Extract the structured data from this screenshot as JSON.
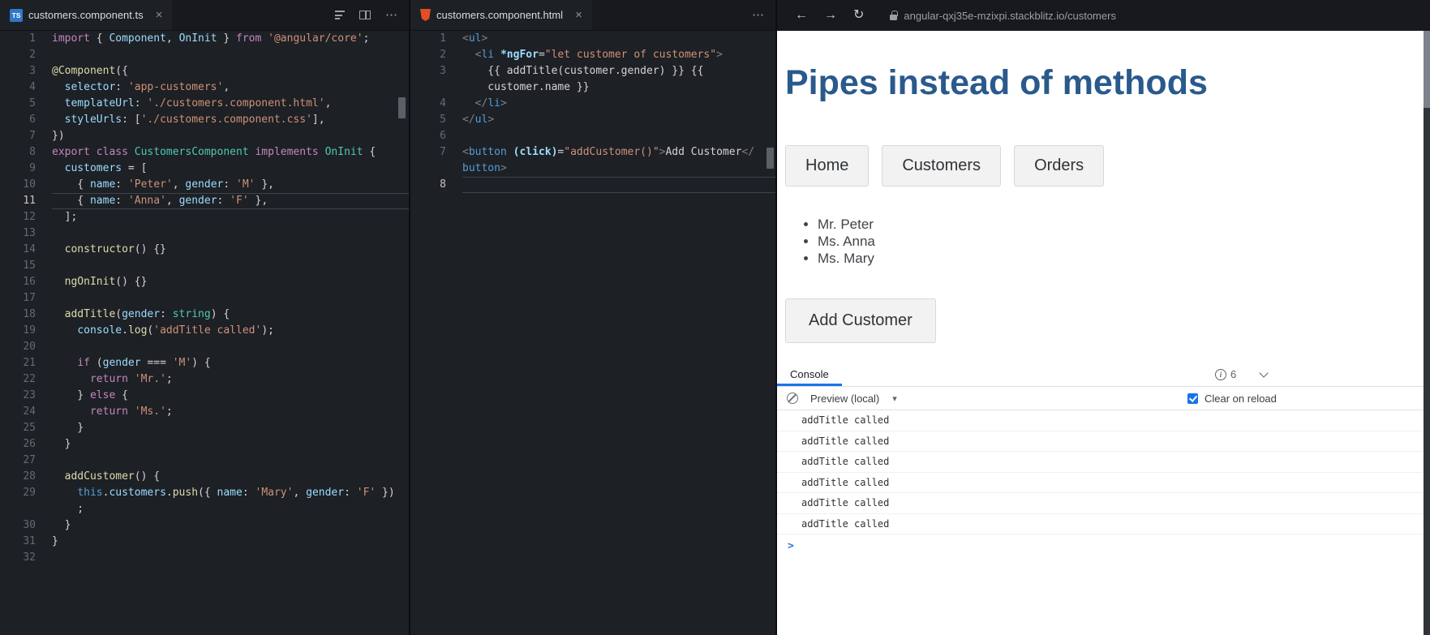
{
  "icons": {
    "close": "×",
    "more": "⋯",
    "back": "←",
    "forward": "→",
    "reload": "↻",
    "caret": "▾",
    "prompt": ">"
  },
  "left_editor": {
    "tab_title": "customers.component.ts",
    "file_icon_label": "TS",
    "rows": [
      {
        "n": "1",
        "segs": [
          [
            "k",
            "import"
          ],
          [
            "p",
            " { "
          ],
          [
            "v",
            "Component"
          ],
          [
            "p",
            ", "
          ],
          [
            "v",
            "OnInit"
          ],
          [
            "p",
            " } "
          ],
          [
            "k",
            "from"
          ],
          [
            "p",
            " "
          ],
          [
            "s",
            "'@angular/core'"
          ],
          [
            "p",
            ";"
          ]
        ]
      },
      {
        "n": "2",
        "segs": []
      },
      {
        "n": "3",
        "segs": [
          [
            "f",
            "@Component"
          ],
          [
            "p",
            "({"
          ]
        ]
      },
      {
        "n": "4",
        "segs": [
          [
            "p",
            "  "
          ],
          [
            "v",
            "selector"
          ],
          [
            "p",
            ": "
          ],
          [
            "s",
            "'app-customers'"
          ],
          [
            "p",
            ","
          ]
        ]
      },
      {
        "n": "5",
        "segs": [
          [
            "p",
            "  "
          ],
          [
            "v",
            "templateUrl"
          ],
          [
            "p",
            ": "
          ],
          [
            "s",
            "'./customers.component.html'"
          ],
          [
            "p",
            ","
          ]
        ]
      },
      {
        "n": "6",
        "segs": [
          [
            "p",
            "  "
          ],
          [
            "v",
            "styleUrls"
          ],
          [
            "p",
            ": ["
          ],
          [
            "s",
            "'./customers.component.css'"
          ],
          [
            "p",
            "],"
          ]
        ]
      },
      {
        "n": "7",
        "segs": [
          [
            "p",
            "})"
          ]
        ]
      },
      {
        "n": "8",
        "segs": [
          [
            "k",
            "export"
          ],
          [
            "p",
            " "
          ],
          [
            "k",
            "class"
          ],
          [
            "p",
            " "
          ],
          [
            "t",
            "CustomersComponent"
          ],
          [
            "p",
            " "
          ],
          [
            "k",
            "implements"
          ],
          [
            "p",
            " "
          ],
          [
            "t",
            "OnInit"
          ],
          [
            "p",
            " {"
          ]
        ]
      },
      {
        "n": "9",
        "segs": [
          [
            "p",
            "  "
          ],
          [
            "v",
            "customers"
          ],
          [
            "p",
            " = ["
          ]
        ]
      },
      {
        "n": "10",
        "segs": [
          [
            "p",
            "    { "
          ],
          [
            "v",
            "name"
          ],
          [
            "p",
            ": "
          ],
          [
            "s",
            "'Peter'"
          ],
          [
            "p",
            ", "
          ],
          [
            "v",
            "gender"
          ],
          [
            "p",
            ": "
          ],
          [
            "s",
            "'M'"
          ],
          [
            "p",
            " },"
          ]
        ]
      },
      {
        "n": "11",
        "cur": true,
        "segs": [
          [
            "p",
            "    { "
          ],
          [
            "v",
            "name"
          ],
          [
            "p",
            ": "
          ],
          [
            "s",
            "'Anna'"
          ],
          [
            "p",
            ", "
          ],
          [
            "v",
            "gender"
          ],
          [
            "p",
            ": "
          ],
          [
            "s",
            "'F'"
          ],
          [
            "p",
            " },"
          ]
        ]
      },
      {
        "n": "12",
        "segs": [
          [
            "p",
            "  ];"
          ]
        ]
      },
      {
        "n": "13",
        "segs": []
      },
      {
        "n": "14",
        "segs": [
          [
            "p",
            "  "
          ],
          [
            "f",
            "constructor"
          ],
          [
            "p",
            "() {}"
          ]
        ]
      },
      {
        "n": "15",
        "segs": []
      },
      {
        "n": "16",
        "segs": [
          [
            "p",
            "  "
          ],
          [
            "f",
            "ngOnInit"
          ],
          [
            "p",
            "() {}"
          ]
        ]
      },
      {
        "n": "17",
        "segs": []
      },
      {
        "n": "18",
        "segs": [
          [
            "p",
            "  "
          ],
          [
            "f",
            "addTitle"
          ],
          [
            "p",
            "("
          ],
          [
            "v",
            "gender"
          ],
          [
            "p",
            ": "
          ],
          [
            "t",
            "string"
          ],
          [
            "p",
            ") {"
          ]
        ]
      },
      {
        "n": "19",
        "segs": [
          [
            "p",
            "    "
          ],
          [
            "v",
            "console"
          ],
          [
            "p",
            "."
          ],
          [
            "f",
            "log"
          ],
          [
            "p",
            "("
          ],
          [
            "s",
            "'addTitle called'"
          ],
          [
            "p",
            ");"
          ]
        ]
      },
      {
        "n": "20",
        "segs": []
      },
      {
        "n": "21",
        "segs": [
          [
            "p",
            "    "
          ],
          [
            "k",
            "if"
          ],
          [
            "p",
            " ("
          ],
          [
            "v",
            "gender"
          ],
          [
            "p",
            " === "
          ],
          [
            "s",
            "'M'"
          ],
          [
            "p",
            ") {"
          ]
        ]
      },
      {
        "n": "22",
        "segs": [
          [
            "p",
            "      "
          ],
          [
            "k",
            "return"
          ],
          [
            "p",
            " "
          ],
          [
            "s",
            "'Mr.'"
          ],
          [
            "p",
            ";"
          ]
        ]
      },
      {
        "n": "23",
        "segs": [
          [
            "p",
            "    } "
          ],
          [
            "k",
            "else"
          ],
          [
            "p",
            " {"
          ]
        ]
      },
      {
        "n": "24",
        "segs": [
          [
            "p",
            "      "
          ],
          [
            "k",
            "return"
          ],
          [
            "p",
            " "
          ],
          [
            "s",
            "'Ms.'"
          ],
          [
            "p",
            ";"
          ]
        ]
      },
      {
        "n": "25",
        "segs": [
          [
            "p",
            "    }"
          ]
        ]
      },
      {
        "n": "26",
        "segs": [
          [
            "p",
            "  }"
          ]
        ]
      },
      {
        "n": "27",
        "segs": []
      },
      {
        "n": "28",
        "segs": [
          [
            "p",
            "  "
          ],
          [
            "f",
            "addCustomer"
          ],
          [
            "p",
            "() {"
          ]
        ]
      },
      {
        "n": "29",
        "segs": [
          [
            "p",
            "    "
          ],
          [
            "b",
            "this"
          ],
          [
            "p",
            "."
          ],
          [
            "v",
            "customers"
          ],
          [
            "p",
            "."
          ],
          [
            "f",
            "push"
          ],
          [
            "p",
            "({ "
          ],
          [
            "v",
            "name"
          ],
          [
            "p",
            ": "
          ],
          [
            "s",
            "'Mary'"
          ],
          [
            "p",
            ", "
          ],
          [
            "v",
            "gender"
          ],
          [
            "p",
            ": "
          ],
          [
            "s",
            "'F'"
          ],
          [
            "p",
            " })"
          ]
        ]
      },
      {
        "n": "",
        "segs": [
          [
            "p",
            "    ;"
          ]
        ]
      },
      {
        "n": "30",
        "segs": [
          [
            "p",
            "  }"
          ]
        ]
      },
      {
        "n": "31",
        "segs": [
          [
            "p",
            "}"
          ]
        ]
      },
      {
        "n": "32",
        "segs": []
      }
    ]
  },
  "mid_editor": {
    "tab_title": "customers.component.html",
    "rows": [
      {
        "n": "1",
        "segs": [
          [
            "d",
            "<"
          ],
          [
            "b",
            "ul"
          ],
          [
            "d",
            ">"
          ]
        ]
      },
      {
        "n": "2",
        "segs": [
          [
            "p",
            "  "
          ],
          [
            "d",
            "<"
          ],
          [
            "b",
            "li"
          ],
          [
            "p",
            " "
          ],
          [
            "a",
            "*ngFor"
          ],
          [
            "p",
            "="
          ],
          [
            "s",
            "\"let customer of customers\""
          ],
          [
            "d",
            ">"
          ]
        ]
      },
      {
        "n": "3",
        "segs": [
          [
            "p",
            "    {{ addTitle(customer.gender) }} {{"
          ]
        ]
      },
      {
        "n": "",
        "segs": [
          [
            "p",
            "    customer.name }}"
          ]
        ]
      },
      {
        "n": "4",
        "segs": [
          [
            "p",
            "  "
          ],
          [
            "d",
            "</"
          ],
          [
            "b",
            "li"
          ],
          [
            "d",
            ">"
          ]
        ]
      },
      {
        "n": "5",
        "segs": [
          [
            "d",
            "</"
          ],
          [
            "b",
            "ul"
          ],
          [
            "d",
            ">"
          ]
        ]
      },
      {
        "n": "6",
        "segs": []
      },
      {
        "n": "7",
        "segs": [
          [
            "d",
            "<"
          ],
          [
            "b",
            "button"
          ],
          [
            "p",
            " "
          ],
          [
            "a",
            "(click)"
          ],
          [
            "p",
            "="
          ],
          [
            "s",
            "\"addCustomer()\""
          ],
          [
            "d",
            ">"
          ],
          [
            "p",
            "Add Customer"
          ],
          [
            "d",
            "</"
          ]
        ]
      },
      {
        "n": "",
        "segs": [
          [
            "b",
            "button"
          ],
          [
            "d",
            ">"
          ]
        ]
      },
      {
        "n": "8",
        "cur": true,
        "segs": []
      }
    ]
  },
  "browser": {
    "url": "angular-qxj35e-mzixpi.stackblitz.io/customers"
  },
  "page": {
    "heading": "Pipes instead of methods",
    "nav_buttons": [
      "Home",
      "Customers",
      "Orders"
    ],
    "customers": [
      "Mr. Peter",
      "Ms. Anna",
      "Ms. Mary"
    ],
    "add_button": "Add Customer"
  },
  "console": {
    "tab": "Console",
    "info_count": "6",
    "dropdown": "Preview (local)",
    "checkbox_label": "Clear on reload",
    "messages": [
      "addTitle called",
      "addTitle called",
      "addTitle called",
      "addTitle called",
      "addTitle called",
      "addTitle called"
    ]
  }
}
